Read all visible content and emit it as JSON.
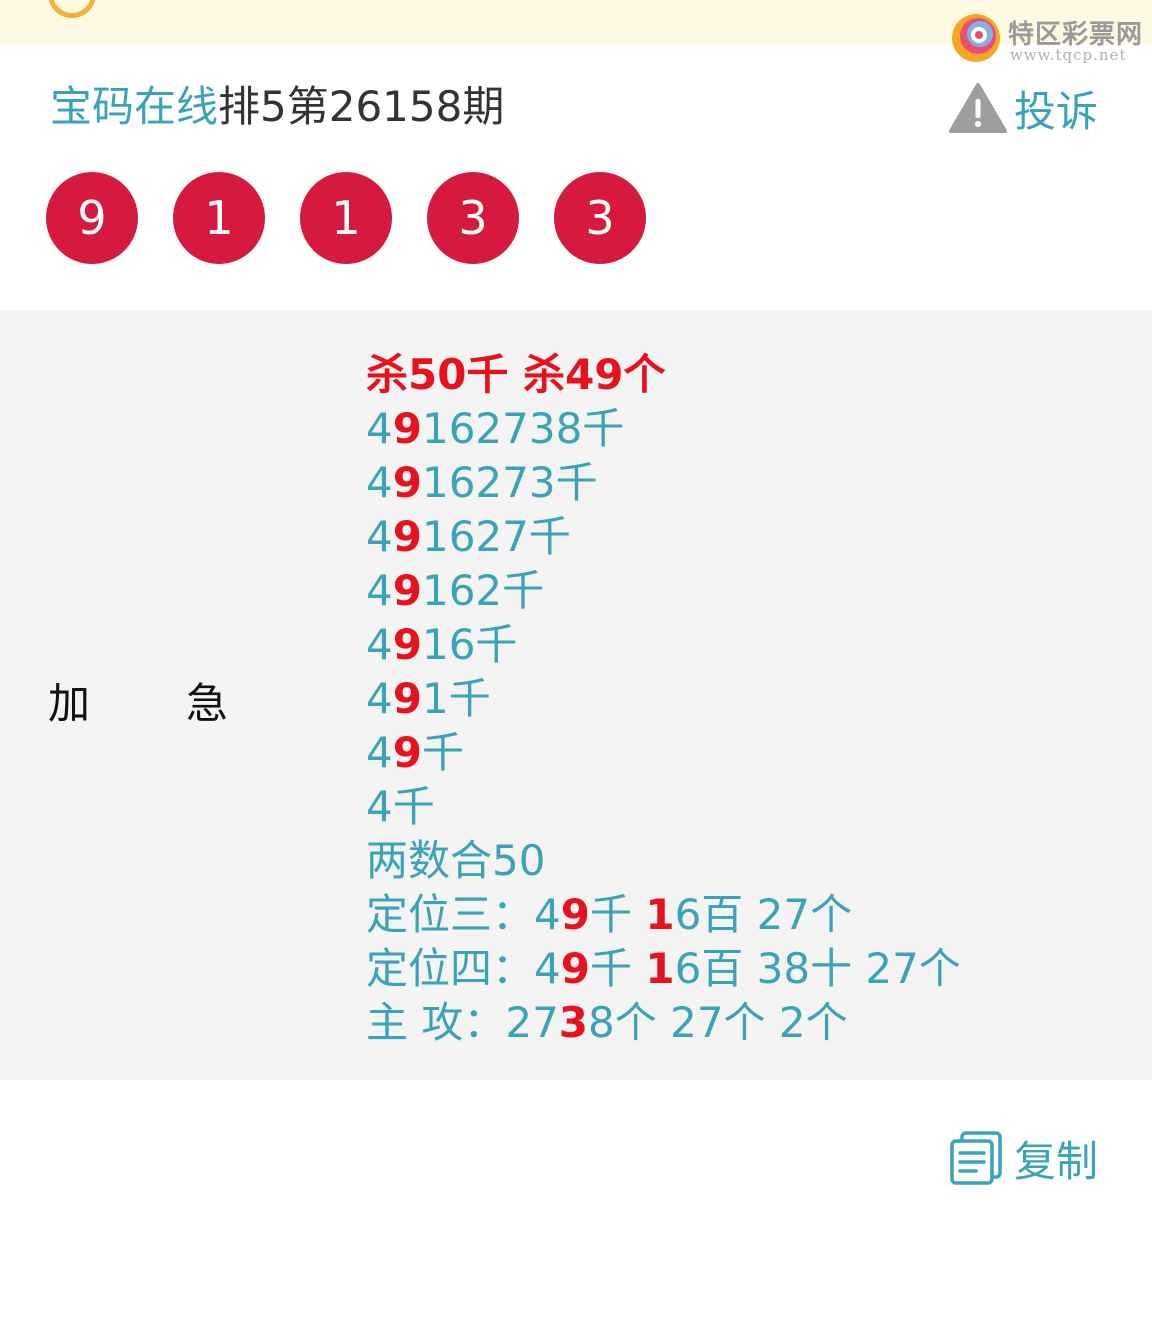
{
  "watermark": {
    "name": "特区彩票网",
    "url": "www.tqcp.net"
  },
  "header": {
    "brand": "宝码在线",
    "issue": "排5第26158期"
  },
  "complaint": {
    "label": "投诉"
  },
  "balls": [
    "9",
    "1",
    "1",
    "3",
    "3"
  ],
  "labels": {
    "left1": "加",
    "left2": "急"
  },
  "headline": "杀50千 杀49个",
  "lines": [
    {
      "pre": "4",
      "hl": "9",
      "post": "162738千"
    },
    {
      "pre": "4",
      "hl": "9",
      "post": "16273千"
    },
    {
      "pre": "4",
      "hl": "9",
      "post": "1627千"
    },
    {
      "pre": "4",
      "hl": "9",
      "post": "162千"
    },
    {
      "pre": "4",
      "hl": "9",
      "post": "16千"
    },
    {
      "pre": "4",
      "hl": "9",
      "post": "1千"
    },
    {
      "pre": "4",
      "hl": "9",
      "post": "千"
    },
    {
      "pre": "4千",
      "hl": "",
      "post": ""
    },
    {
      "pre": "两数合50",
      "hl": "",
      "post": ""
    }
  ],
  "position3": {
    "a": "定位三：4",
    "b": "9",
    "c": "千 ",
    "d": "1",
    "e": "6百 27个"
  },
  "position4": {
    "a": "定位四：4",
    "b": "9",
    "c": "千 ",
    "d": "1",
    "e": "6百 38十 27个"
  },
  "main_attack": {
    "a": "主 攻：27",
    "b": "3",
    "c": "8个 27个 2个"
  },
  "copy": {
    "label": "复制"
  },
  "colors": {
    "accent": "#3aa3b8",
    "ball": "#d6193f",
    "highlight": "#e8111e"
  }
}
